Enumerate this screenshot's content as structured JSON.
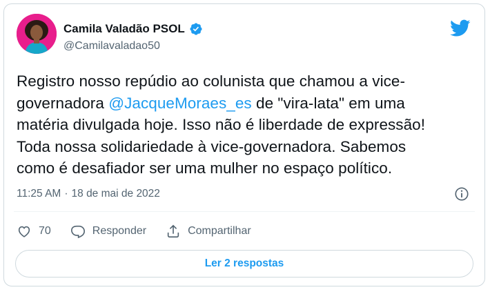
{
  "author": {
    "display_name": "Camila Valadão PSOL",
    "handle": "@Camilavaladao50"
  },
  "tweet": {
    "text_before": "Registro nosso repúdio ao colunista que chamou a vice-\ngovernadora ",
    "mention": "@JacqueMoraes_es",
    "text_after": " de \"vira-lata\" em uma\nmatéria divulgada hoje. Isso não é liberdade de expressão!\nToda nossa solidariedade à vice-governadora. Sabemos\ncomo é desafiador ser uma mulher no espaço político.",
    "time": "11:25 AM",
    "separator": "·",
    "date": "18 de mai de 2022"
  },
  "actions": {
    "likes_count": "70",
    "reply_label": "Responder",
    "share_label": "Compartilhar"
  },
  "replies_button_label": "Ler 2 respostas",
  "colors": {
    "accent": "#1d9bf0",
    "text": "#0f1419",
    "secondary": "#536471",
    "avatar_bg": "#e81e8c"
  }
}
